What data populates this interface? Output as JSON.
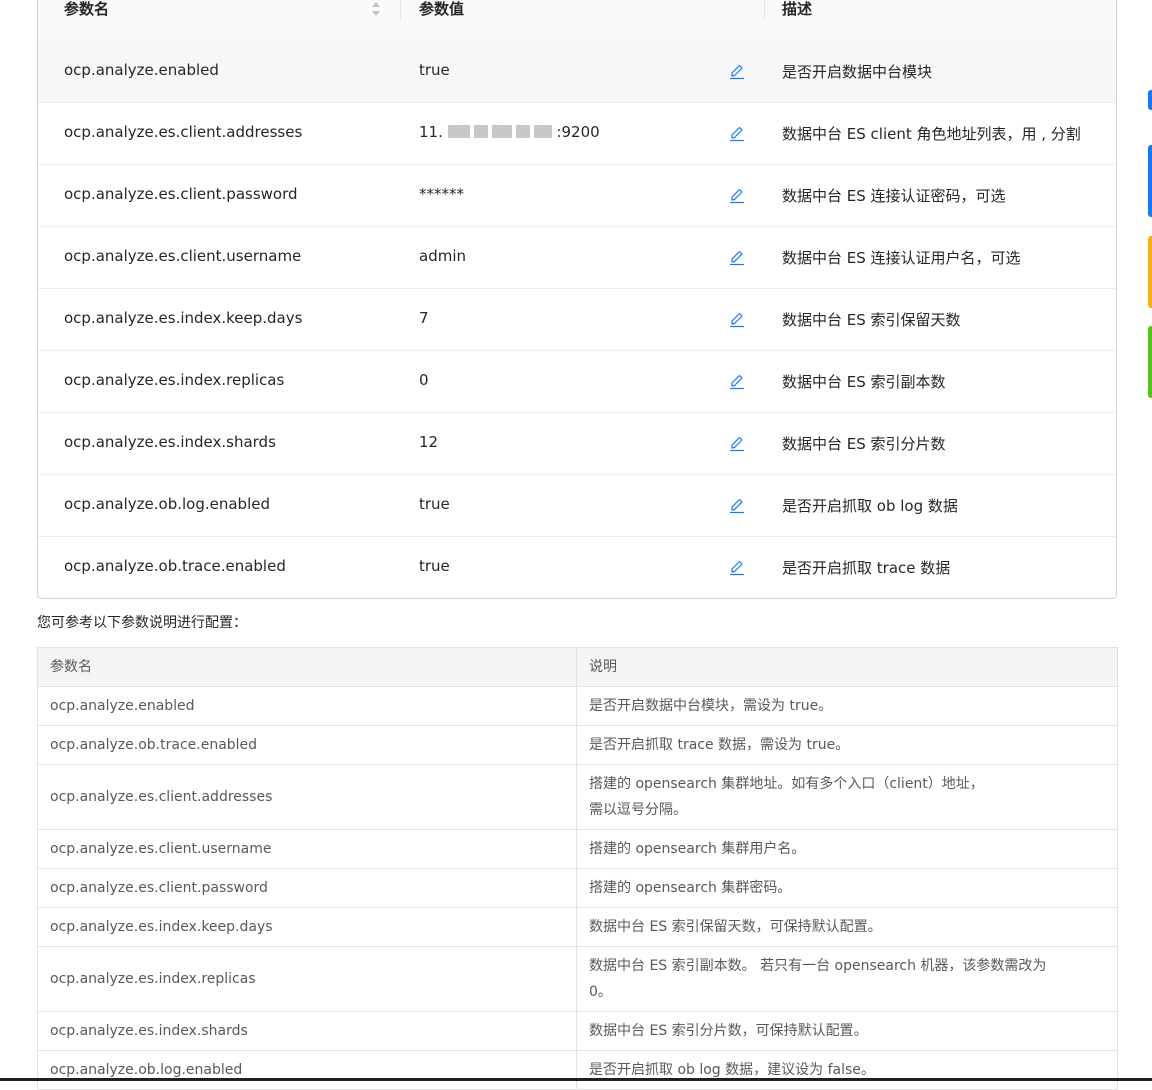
{
  "param_table": {
    "headers": {
      "name": "参数名",
      "value": "参数值",
      "desc": "描述"
    },
    "rows": [
      {
        "name": "ocp.analyze.enabled",
        "value": "true",
        "desc": "是否开启数据中台模块"
      },
      {
        "name": "ocp.analyze.es.client.addresses",
        "value_prefix": "11.",
        "value_suffix": ":9200",
        "desc": "数据中台 ES client 角色地址列表，用 , 分割"
      },
      {
        "name": "ocp.analyze.es.client.password",
        "value": "******",
        "desc": "数据中台 ES 连接认证密码，可选"
      },
      {
        "name": "ocp.analyze.es.client.username",
        "value": "admin",
        "desc": "数据中台 ES 连接认证用户名，可选"
      },
      {
        "name": "ocp.analyze.es.index.keep.days",
        "value": "7",
        "desc": "数据中台 ES 索引保留天数"
      },
      {
        "name": "ocp.analyze.es.index.replicas",
        "value": "0",
        "desc": "数据中台 ES 索引副本数"
      },
      {
        "name": "ocp.analyze.es.index.shards",
        "value": "12",
        "desc": "数据中台 ES 索引分片数"
      },
      {
        "name": "ocp.analyze.ob.log.enabled",
        "value": "true",
        "desc": "是否开启抓取 ob log 数据"
      },
      {
        "name": "ocp.analyze.ob.trace.enabled",
        "value": "true",
        "desc": "是否开启抓取 trace 数据"
      }
    ]
  },
  "intro_text": "您可参考以下参数说明进行配置：",
  "doc_table": {
    "headers": {
      "name": "参数名",
      "desc": "说明"
    },
    "rows": [
      {
        "name": "ocp.analyze.enabled",
        "desc": "是否开启数据中台模块，需设为 true。"
      },
      {
        "name": "ocp.analyze.ob.trace.enabled",
        "desc": "是否开启抓取 trace 数据，需设为 true。"
      },
      {
        "name": "ocp.analyze.es.client.addresses",
        "desc1": "搭建的 opensearch 集群地址。如有多个入口（client）地址，",
        "desc2": "需以逗号分隔。"
      },
      {
        "name": "ocp.analyze.es.client.username",
        "desc": "搭建的 opensearch 集群用户名。"
      },
      {
        "name": "ocp.analyze.es.client.password",
        "desc": "搭建的 opensearch 集群密码。"
      },
      {
        "name": "ocp.analyze.es.index.keep.days",
        "desc": "数据中台 ES 索引保留天数，可保持默认配置。"
      },
      {
        "name": "ocp.analyze.es.index.replicas",
        "desc1": "数据中台 ES 索引副本数。 若只有一台 opensearch 机器，该参数需改为",
        "desc2": "0。"
      },
      {
        "name": "ocp.analyze.es.index.shards",
        "desc": "数据中台 ES 索引分片数，可保持默认配置。"
      },
      {
        "name": "ocp.analyze.ob.log.enabled",
        "desc": "是否开启抓取 ob log 数据，建议设为 false。"
      }
    ]
  },
  "colors": {
    "edit_icon": "#1677ff",
    "side_blue": "#1677ff",
    "side_orange": "#faad14",
    "side_green": "#52c41a"
  }
}
